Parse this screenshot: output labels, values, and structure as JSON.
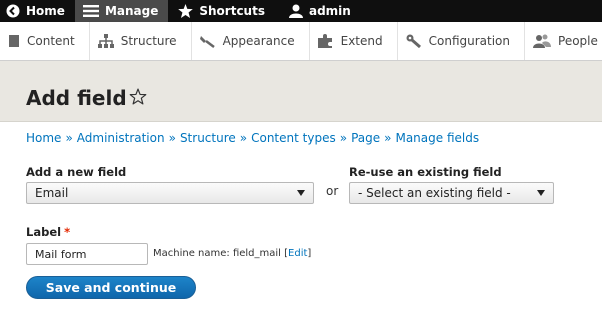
{
  "toolbar": {
    "items": [
      {
        "label": "Home",
        "icon": "home-icon"
      },
      {
        "label": "Manage",
        "icon": "menu-icon"
      },
      {
        "label": "Shortcuts",
        "icon": "star-icon"
      },
      {
        "label": "admin",
        "icon": "user-icon"
      }
    ]
  },
  "tray": {
    "items": [
      {
        "label": "Content",
        "icon": "content-icon"
      },
      {
        "label": "Structure",
        "icon": "structure-icon"
      },
      {
        "label": "Appearance",
        "icon": "appearance-icon"
      },
      {
        "label": "Extend",
        "icon": "extend-icon"
      },
      {
        "label": "Configuration",
        "icon": "wrench-icon"
      },
      {
        "label": "People",
        "icon": "people-icon"
      }
    ]
  },
  "page": {
    "title": "Add field"
  },
  "breadcrumb": [
    "Home",
    "Administration",
    "Structure",
    "Content types",
    "Page",
    "Manage fields"
  ],
  "breadcrumb_separator": "»",
  "form": {
    "new_field_label": "Add a new field",
    "new_field_value": "Email",
    "or_text": "or",
    "existing_field_label": "Re-use an existing field",
    "existing_field_value": "- Select an existing field -",
    "label_label": "Label",
    "required_mark": "*",
    "label_value": "Mail form",
    "machine_name_prefix": "Machine name: field_mail",
    "machine_edit_open": " [",
    "machine_edit_link": "Edit",
    "machine_edit_close": "]",
    "submit_label": "Save and continue"
  },
  "colors": {
    "link": "#0074bd",
    "primary_button": "#1577bd",
    "header_band": "#e9e7e1",
    "toolbar": "#0f0f0f"
  }
}
